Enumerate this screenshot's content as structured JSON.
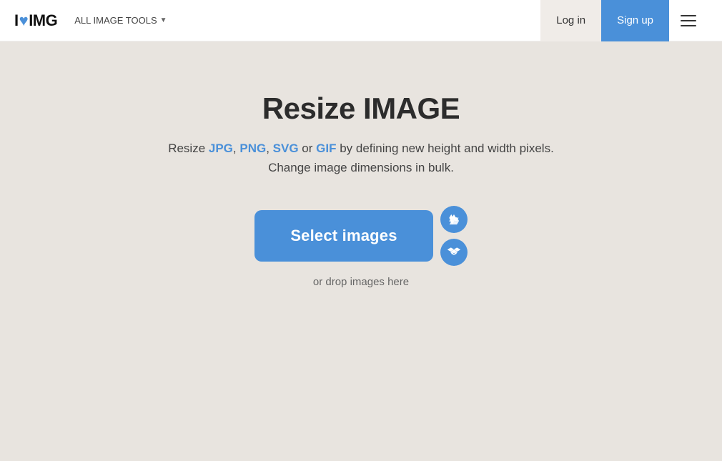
{
  "header": {
    "logo_i": "I",
    "logo_heart": "♥",
    "logo_img": "IMG",
    "all_tools_label": "ALL IMAGE TOOLS",
    "login_label": "Log in",
    "signup_label": "Sign up"
  },
  "main": {
    "title": "Resize IMAGE",
    "subtitle_prefix": "Resize ",
    "format_jpg": "JPG",
    "comma1": ", ",
    "format_png": "PNG",
    "comma2": ", ",
    "format_svg": "SVG",
    "or_text": " or ",
    "format_gif": "GIF",
    "subtitle_suffix": " by defining new height and width pixels.",
    "subtitle_line2": "Change image dimensions in bulk.",
    "select_btn_label": "Select images",
    "drop_text": "or drop images here",
    "gdrive_icon": "google-drive-icon",
    "dropbox_icon": "dropbox-icon"
  }
}
